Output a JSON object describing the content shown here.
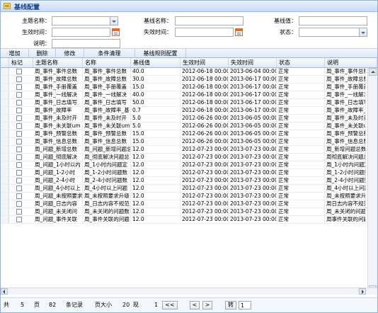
{
  "window": {
    "title": "基线配置"
  },
  "form": {
    "topic_label": "主题名称：",
    "baseline_name_label": "基线名称：",
    "baseline_value_label": "基线值：",
    "effective_time_label": "生效时间：",
    "expire_time_label": "失效时间：",
    "status_label": "状态：",
    "description_label": "说明："
  },
  "toolbar": {
    "add": "增加",
    "delete": "删除",
    "edit": "修改",
    "clear": "条件清理",
    "rule_config": "基线规则配置"
  },
  "grid": {
    "columns": [
      "标记",
      "主题名称",
      "名称",
      "基线值",
      "生效时间",
      "失效时间",
      "状态",
      "说明"
    ],
    "rows": [
      [
        "周_事件_事件总数",
        "周_事件_事件总数",
        "40.0",
        "2012-06-18 00:00:",
        "2013-06-04 00:00:",
        "正常",
        "周_事件_事件总数"
      ],
      [
        "周_事件_故障总数",
        "周_事件_故障总数",
        "30.0",
        "2012-06-18 00:00:",
        "2013-06-17 00:00:",
        "正常",
        "周_事件_故障总数"
      ],
      [
        "周_事件_手册覆盖",
        "周_事件_手册覆盖",
        "15.0",
        "2012-06-18 00:00:",
        "2013-06-17 00:00:",
        "正常",
        "周_事件_手册覆盖"
      ],
      [
        "周_事件_一线解决",
        "周_事件_一线解决",
        "40.0",
        "2012-06-18 00:00:",
        "2013-06-17 00:00:",
        "正常",
        "周_事件_一线解决"
      ],
      [
        "周_事件_日志填写",
        "周_事件_日志填写",
        "50.0",
        "2012-06-18 00:00:",
        "2013-06-17 00:00:",
        "正常",
        "周_事件_日志填写"
      ],
      [
        "周_事件_故障率",
        "周_事件_故障率_基",
        "0.7",
        "2012-06-18 00:00:",
        "2013-06-17 00:00:",
        "正常",
        "周_事件_故障率_基"
      ],
      [
        "周_事件_未及时开",
        "周_事件_未及时开",
        "5.0",
        "2012-06-26 00:00:",
        "2013-06-05 00:00:",
        "正常",
        "周_事件_未及时开"
      ],
      [
        "周_事件_未关联um",
        "周_事件_未关联um",
        "5.0",
        "2012-06-26 00:00:",
        "2013-06-05 00:00:",
        "正常",
        "周_事件_未关联um"
      ],
      [
        "周_事件_预警总数",
        "周_事件_预警总数",
        "15.0",
        "2012-06-26 00:00:",
        "2013-06-05 00:00:",
        "正常",
        "周_事件_预警总数"
      ],
      [
        "周_事件_信息总数",
        "周_事件_信息总数",
        "15.0",
        "2012-06-26 00:00:",
        "2013-06-05 00:00:",
        "正常",
        "周_事件_信息总数"
      ],
      [
        "周_问题_新增总数",
        "周_问题_新增问题总",
        "12.0",
        "2012-07-23 00:00:",
        "2013-07-23 00:00:",
        "正常",
        "周_新增问题总数_基"
      ],
      [
        "周_问题_彻底解决",
        "周_彻底解决问题总",
        "12.0",
        "2012-07-23 00:00:",
        "2013-07-23 00:00:",
        "正常",
        "周彻底解决问题总"
      ],
      [
        "周_问题_1小时以内",
        "周_1小时内问题定",
        "12.0",
        "2012-07-23 00:00:",
        "2013-07-23 00:00:",
        "正常",
        "周_1小时内问题定位"
      ],
      [
        "周_问题_1-2小时",
        "周_1-2小时问题数",
        "12.0",
        "2012-07-23 00:00:",
        "2013-07-23 00:00:",
        "正常",
        "周_1-2小时问题数"
      ],
      [
        "周_问题_2-4小时",
        "周_2-4小时问题数",
        "12.0",
        "2012-07-23 00:00:",
        "2013-07-23 00:00:",
        "正常",
        "周_2-4小时问题数"
      ],
      [
        "周_问题_4小时以上",
        "周_4小时以上问题",
        "12.0",
        "2012-07-23 00:00:",
        "2013-07-23 00:00:",
        "正常",
        "周_4小时以上问题数"
      ],
      [
        "周_问题_未按照要求",
        "周_未按照要求升级",
        "12.0",
        "2012-07-23 00:00:",
        "2013-07-23 00:00:",
        "正常",
        "周_未按照要求升级"
      ],
      [
        "周_问题_日志内容",
        "周_日志内容不规范",
        "12.0",
        "2012-07-23 00:00:",
        "2013-07-23 00:00:",
        "正常",
        "周日志内容不规范"
      ],
      [
        "周_问题_未关闭问",
        "周_未关闭的问题数",
        "12.0",
        "2012-07-23 00:00:",
        "2013-07-23 00:00:",
        "正常",
        "周_未关闭的问题数"
      ],
      [
        "周_问题_事件关联",
        "周_事件关联的问题",
        "12.0",
        "2012-07-23 00:00:",
        "2013-07-23 00:00:",
        "正常",
        "周事件关联的问题数"
      ]
    ]
  },
  "pager": {
    "total_label": "共",
    "pages": "5",
    "pages_label": "页",
    "records": "82",
    "records_label": "条记录",
    "page_size_label": "页大小",
    "page_size": "20",
    "page_size_suffix": "现",
    "current": "1",
    "first": "<<",
    "prev": "<",
    "next": ">",
    "goto_label": "转",
    "goto_value": "1"
  }
}
